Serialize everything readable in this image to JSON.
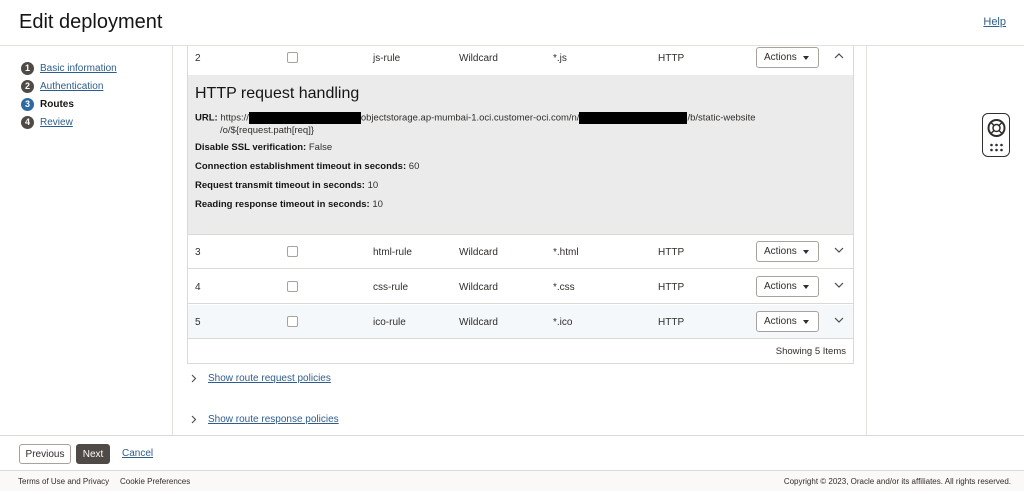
{
  "header": {
    "title": "Edit deployment",
    "help": "Help"
  },
  "steps": [
    {
      "num": "1",
      "label": "Basic information"
    },
    {
      "num": "2",
      "label": "Authentication"
    },
    {
      "num": "3",
      "label": "Routes"
    },
    {
      "num": "4",
      "label": "Review"
    }
  ],
  "rows": [
    {
      "num": "2",
      "name": "js-rule",
      "type": "Wildcard",
      "pattern": "*.js",
      "backend": "HTTP",
      "actions": "Actions"
    },
    {
      "num": "3",
      "name": "html-rule",
      "type": "Wildcard",
      "pattern": "*.html",
      "backend": "HTTP",
      "actions": "Actions"
    },
    {
      "num": "4",
      "name": "css-rule",
      "type": "Wildcard",
      "pattern": "*.css",
      "backend": "HTTP",
      "actions": "Actions"
    },
    {
      "num": "5",
      "name": "ico-rule",
      "type": "Wildcard",
      "pattern": "*.ico",
      "backend": "HTTP",
      "actions": "Actions"
    }
  ],
  "expanded": {
    "heading": "HTTP request handling",
    "url_label": "URL:",
    "url_prefix": "https://",
    "url_mid": "objectstorage.ap-mumbai-1.oci.customer-oci.com/n/",
    "url_end": "/b/static-website",
    "url_line2": "/o/${request.path[req]}",
    "ssl_label": "Disable SSL verification:",
    "ssl_value": "False",
    "conn_label": "Connection establishment timeout in seconds:",
    "conn_value": "60",
    "transmit_label": "Request transmit timeout in seconds:",
    "transmit_value": "10",
    "read_label": "Reading response timeout in seconds:",
    "read_value": "10"
  },
  "table_footer": "Showing 5 Items",
  "policies": {
    "request": "Show route request policies",
    "response": "Show route response policies"
  },
  "bottom": {
    "previous": "Previous",
    "next": "Next",
    "cancel": "Cancel"
  },
  "pagefoot": {
    "terms": "Terms of Use and Privacy",
    "cookies": "Cookie Preferences",
    "copyright": "Copyright © 2023, Oracle and/or its affiliates. All rights reserved."
  }
}
